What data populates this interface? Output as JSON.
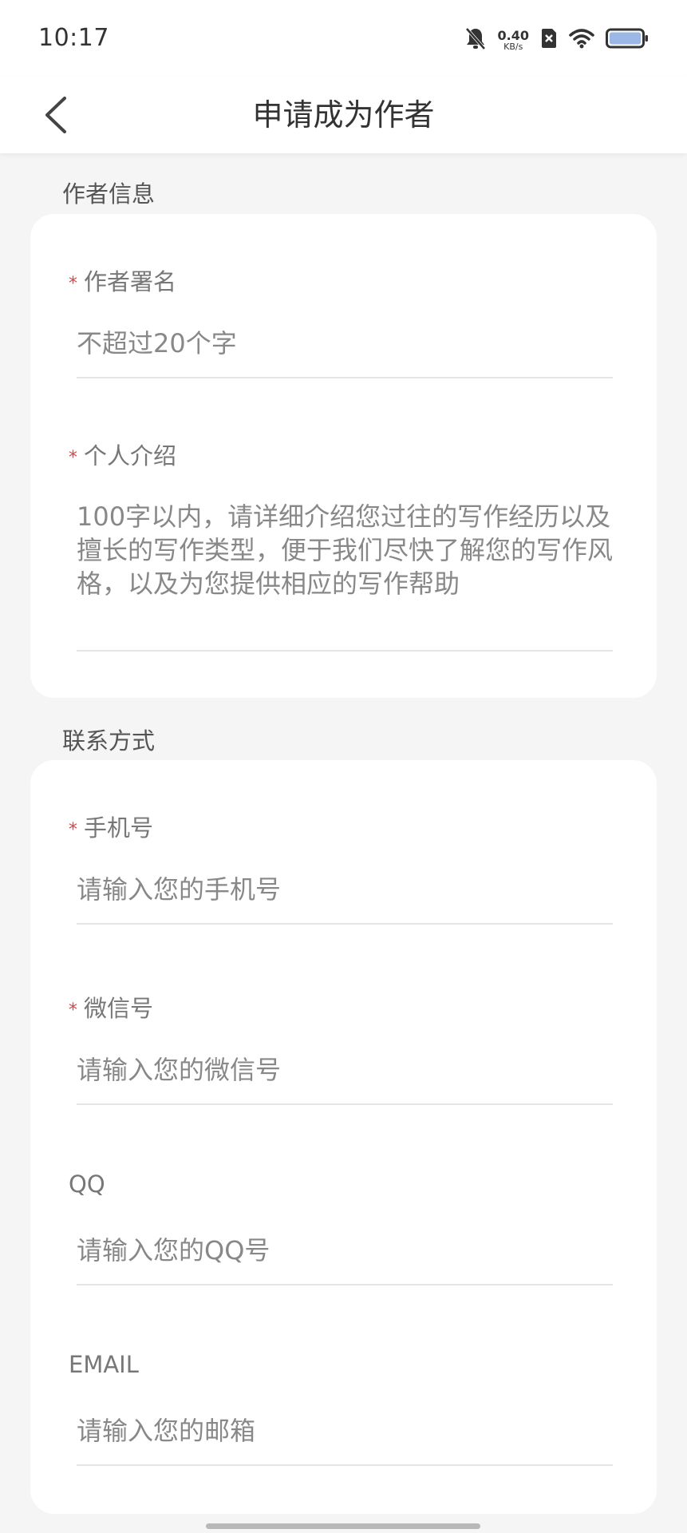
{
  "status_bar": {
    "time": "10:17",
    "net_speed_value": "0.40",
    "net_speed_unit": "KB/s",
    "icons": [
      "bell-muted-icon",
      "sim-x-icon",
      "wifi-icon",
      "battery-icon"
    ]
  },
  "nav": {
    "title": "申请成为作者",
    "back_icon": "chevron-left-icon"
  },
  "sections": {
    "author_info": {
      "title": "作者信息",
      "pen_name": {
        "required_mark": "*",
        "label": "作者署名",
        "placeholder": "不超过20个字"
      },
      "intro": {
        "required_mark": "*",
        "label": "个人介绍",
        "placeholder": "100字以内，请详细介绍您过往的写作经历以及擅长的写作类型，便于我们尽快了解您的写作风格，以及为您提供相应的写作帮助"
      }
    },
    "contact": {
      "title": "联系方式",
      "phone": {
        "required_mark": "*",
        "label": "手机号",
        "placeholder": "请输入您的手机号"
      },
      "wechat": {
        "required_mark": "*",
        "label": "微信号",
        "placeholder": "请输入您的微信号"
      },
      "qq": {
        "label": "QQ",
        "placeholder": "请输入您的QQ号"
      },
      "email": {
        "label": "EMAIL",
        "placeholder": "请输入您的邮箱"
      }
    }
  },
  "colors": {
    "background": "#f5f5f5",
    "card": "#ffffff",
    "required": "#e0404a",
    "text": "#333333",
    "placeholder": "#888888"
  }
}
